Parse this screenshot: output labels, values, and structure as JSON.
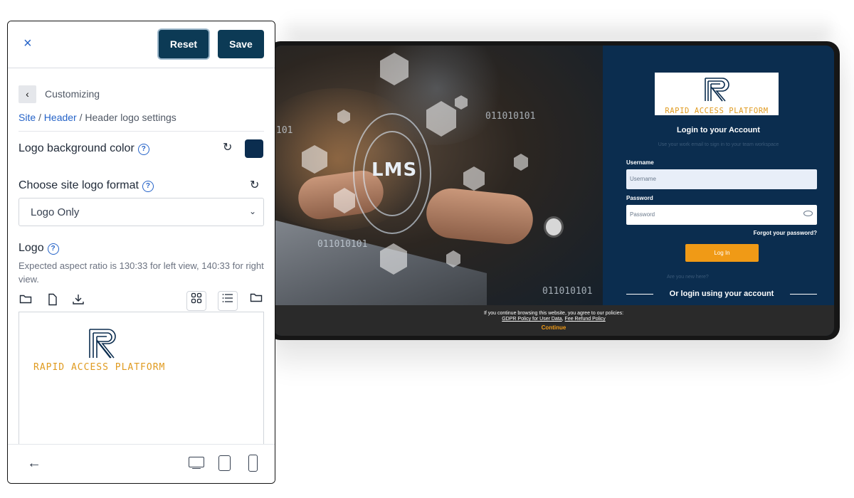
{
  "panel": {
    "close_label": "×",
    "reset_label": "Reset",
    "save_label": "Save",
    "back_label": "‹",
    "section_title": "Customizing",
    "breadcrumb": {
      "site": "Site",
      "sep1": " / ",
      "header": "Header",
      "sep2": " / ",
      "current": "Header logo settings"
    },
    "logo_bg_label": "Logo background color",
    "logo_bg_color": "#0b2d4f",
    "format_label": "Choose site logo format",
    "format_value": "Logo Only",
    "logo_label": "Logo",
    "logo_hint": "Expected aspect ratio is 130:33 for left view, 140:33 for right view.",
    "help_glyph": "?",
    "refresh_glyph": "↻",
    "chevron_glyph": "⌄",
    "brand_text": "RAPID ACCESS PLATFORM",
    "footer_back": "←"
  },
  "preview": {
    "lms_text": "LMS",
    "binary_1": "011010101",
    "binary_2": "011010101",
    "binary_3": "011010101",
    "binary_4": "101",
    "brand_text": "RAPID ACCESS PLATFORM",
    "login_title": "Login to your Account",
    "login_subtitle": "Use your work email to sign in to your team workspace",
    "username_label": "Username",
    "username_placeholder": "Username",
    "password_label": "Password",
    "password_placeholder": "Password",
    "forgot_label": "Forgot your password?",
    "login_button": "Log In",
    "new_here": "Are you new here?",
    "or_login": "Or login using your account",
    "cookie_line1": "If you continue browsing this website, you agree to our policies:",
    "cookie_link1": "GDPR Policy for User Data",
    "cookie_comma": ", ",
    "cookie_link2": "Fee Refund Policy",
    "cookie_continue": "Continue"
  },
  "colors": {
    "brand_navy": "#0b2d4f",
    "accent_orange": "#f09a16",
    "link_blue": "#2563c8"
  },
  "icons": [
    "close-icon",
    "chevron-left-icon",
    "help-icon",
    "refresh-icon",
    "chevron-down-icon",
    "folder-icon",
    "file-icon",
    "download-icon",
    "grid-icon",
    "list-icon",
    "arrow-left-icon",
    "desktop-icon",
    "tablet-icon",
    "mobile-icon",
    "eye-icon"
  ]
}
